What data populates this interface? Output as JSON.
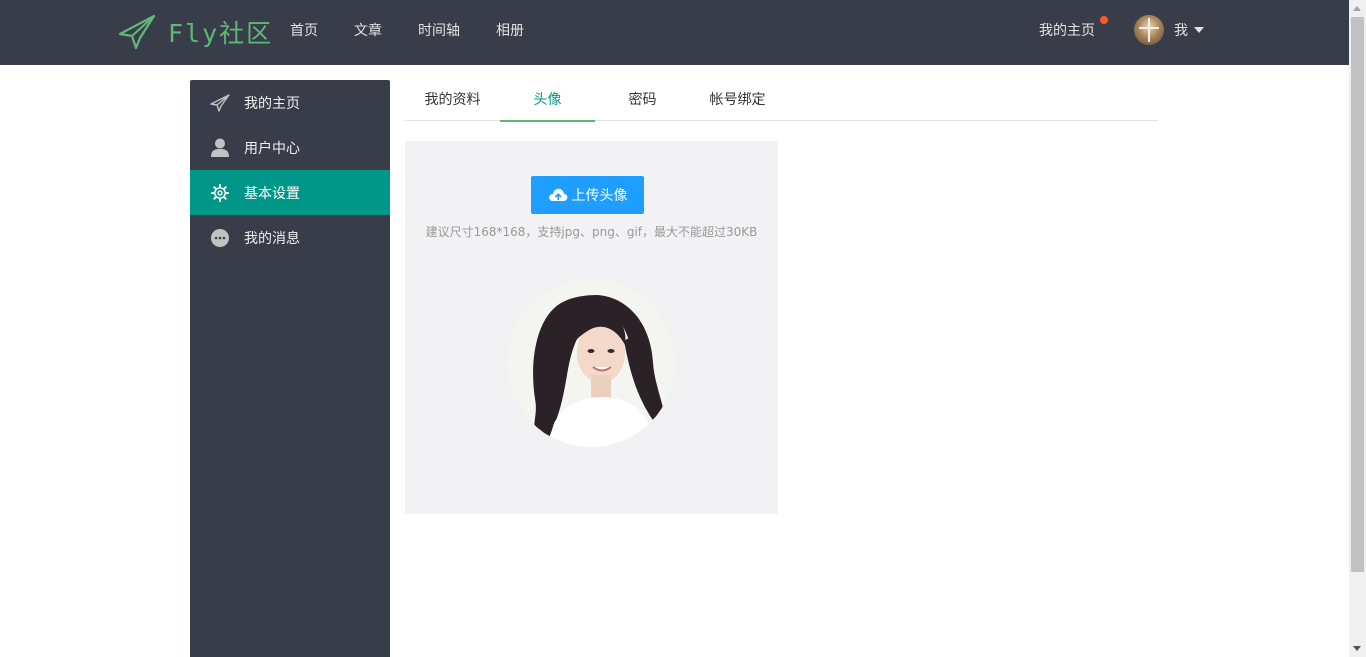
{
  "header": {
    "logo_text": "Fly社区",
    "nav": [
      "首页",
      "文章",
      "时间轴",
      "相册"
    ],
    "home_link": "我的主页",
    "user_label": "我"
  },
  "sidebar": {
    "items": [
      {
        "label": "我的主页",
        "icon": "paper-plane-icon"
      },
      {
        "label": "用户中心",
        "icon": "user-icon"
      },
      {
        "label": "基本设置",
        "icon": "gear-icon",
        "active": true
      },
      {
        "label": "我的消息",
        "icon": "chat-bubble-icon"
      }
    ]
  },
  "tabs": [
    {
      "label": "我的资料"
    },
    {
      "label": "头像",
      "active": true
    },
    {
      "label": "密码"
    },
    {
      "label": "帐号绑定"
    }
  ],
  "avatar_panel": {
    "upload_label": "上传头像",
    "hint": "建议尺寸168*168，支持jpg、png、gif，最大不能超过30KB"
  },
  "colors": {
    "header_bg": "#393d49",
    "active_green": "#009688",
    "logo_green": "#5fb878",
    "button_blue": "#1e9fff",
    "notify_dot": "#ff5722"
  }
}
